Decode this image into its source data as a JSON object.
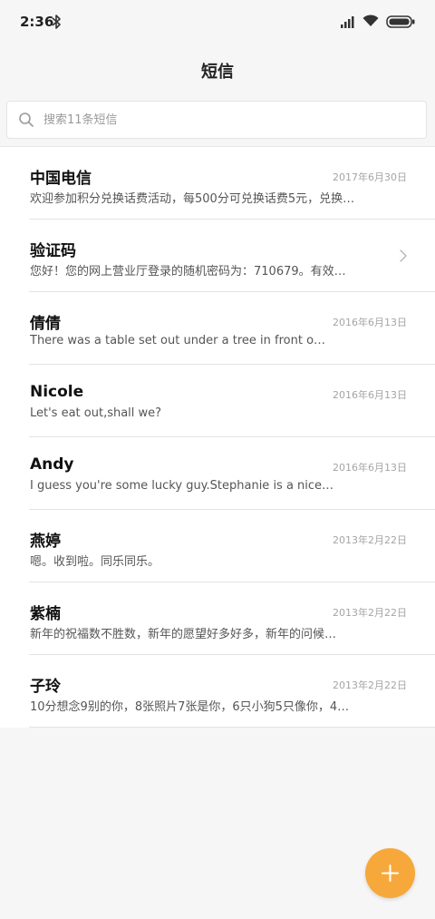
{
  "status_bar": {
    "time": "2:36"
  },
  "header": {
    "title": "短信"
  },
  "search": {
    "placeholder": "搜索11条短信"
  },
  "messages": [
    {
      "name": "中国电信",
      "date": "2017年6月30日",
      "preview": "欢迎参加积分兑换话费活动，每500分可兑换话费5元，兑换…"
    },
    {
      "name": "验证码",
      "date": "",
      "preview": "您好！您的网上营业厅登录的随机密码为：710679。有效…"
    },
    {
      "name": "倩倩",
      "date": "2016年6月13日",
      "preview": "There was a table set out under a tree in front o…"
    },
    {
      "name": "Nicole",
      "date": "2016年6月13日",
      "preview": "Let's eat out,shall we?"
    },
    {
      "name": "Andy",
      "date": "2016年6月13日",
      "preview": "I guess you're some lucky guy.Stephanie is a nice…"
    },
    {
      "name": "燕婷",
      "date": "2013年2月22日",
      "preview": "嗯。收到啦。同乐同乐。"
    },
    {
      "name": "紫楠",
      "date": "2013年2月22日",
      "preview": "新年的祝福数不胜数，新年的愿望好多好多，新年的问候…"
    },
    {
      "name": "子玲",
      "date": "2013年2月22日",
      "preview": "10分想念9别的你，8张照片7张是你，6只小狗5只像你，4…"
    }
  ],
  "colors": {
    "accent": "#f7a83a",
    "background": "#f6f6f6",
    "list_background": "#ffffff",
    "date_text": "#a5a5a5"
  },
  "icons": {
    "bluetooth": "bluetooth-icon",
    "signal": "signal-icon",
    "wifi": "wifi-icon",
    "battery": "battery-icon",
    "search": "search-icon",
    "chevron": "chevron-right-icon",
    "fab": "plus-icon"
  }
}
